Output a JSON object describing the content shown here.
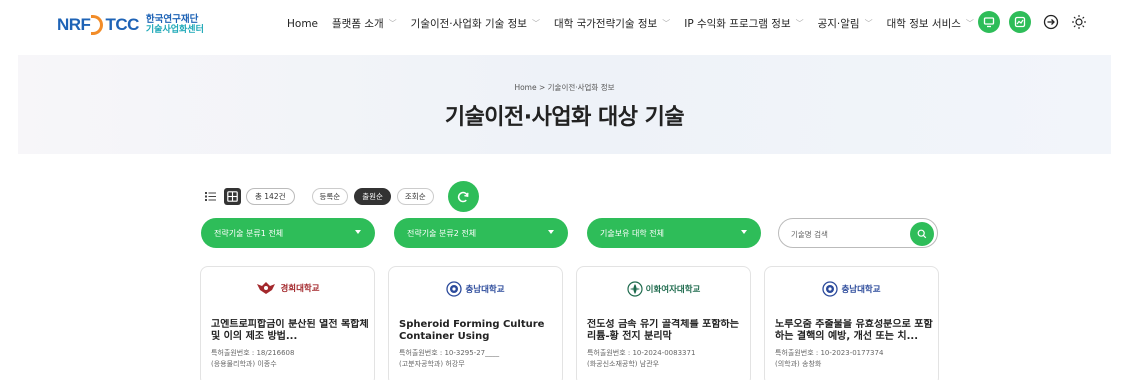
{
  "header": {
    "logo": {
      "nrf": "NRF",
      "tcc": "TCC",
      "line1": "한국연구재단",
      "line2": "기술사업화센터"
    },
    "nav": [
      {
        "label": "Home",
        "has_dropdown": false
      },
      {
        "label": "플랫폼 소개",
        "has_dropdown": true
      },
      {
        "label": "기술이전·사업화 기술 정보",
        "has_dropdown": true
      },
      {
        "label": "대학 국가전략기술 정보",
        "has_dropdown": true
      },
      {
        "label": "IP 수익화 프로그램 정보",
        "has_dropdown": true
      },
      {
        "label": "공지·알림",
        "has_dropdown": true
      },
      {
        "label": "대학 정보 서비스",
        "has_dropdown": true
      }
    ],
    "icons": [
      "monitor-icon",
      "chart-icon",
      "login-icon",
      "sun-icon"
    ]
  },
  "hero": {
    "breadcrumb": "Home > 기술이전·사업화 정보",
    "title": "기술이전·사업화 대상 기술"
  },
  "toolbar": {
    "count_label": "총 142건",
    "sorts": [
      {
        "label": "등록순",
        "active": false
      },
      {
        "label": "출원순",
        "active": true
      },
      {
        "label": "조회순",
        "active": false
      }
    ]
  },
  "filters": {
    "f1": "전략기술 분류1 전체",
    "f2": "전략기술 분류2 전체",
    "f3": "기술보유 대학 전체",
    "search_placeholder": "기술명 검색"
  },
  "cards": [
    {
      "university": "경희대학교",
      "title": "고엔트로피합금이 분산된 열전 복합체 및 이의 제조 방법...",
      "patent": "특허출원번호 : 18/216608",
      "dept": "(응용물리학과) 이종수"
    },
    {
      "university": "충남대학교",
      "title": "Spheroid Forming Culture Container Using Temperature...",
      "patent": "특허출원번호 : 10-3295-27____",
      "dept": "(고분자공학과) 허강무"
    },
    {
      "university": "이화여자대학교",
      "title": "전도성 금속 유기 골격체를 포함하는 리튬-황 전지 분리막",
      "patent": "특허출원번호 : 10-2024-0083371",
      "dept": "(화공신소재공학) 남관우"
    },
    {
      "university": "충남대학교",
      "title": "노루오줌 추출물을 유효성분으로 포함하는 결핵의 예방, 개선 또는 치...",
      "patent": "특허출원번호 : 10-2023-0177374",
      "dept": "(의학과) 송창화"
    }
  ],
  "colors": {
    "accent": "#2ebd59",
    "brand_blue": "#1e63b6",
    "brand_orange": "#f28c28",
    "kyunghee_red": "#a3282c",
    "cnu_blue": "#2b4a9b",
    "ewha_green": "#1f6b4e"
  }
}
